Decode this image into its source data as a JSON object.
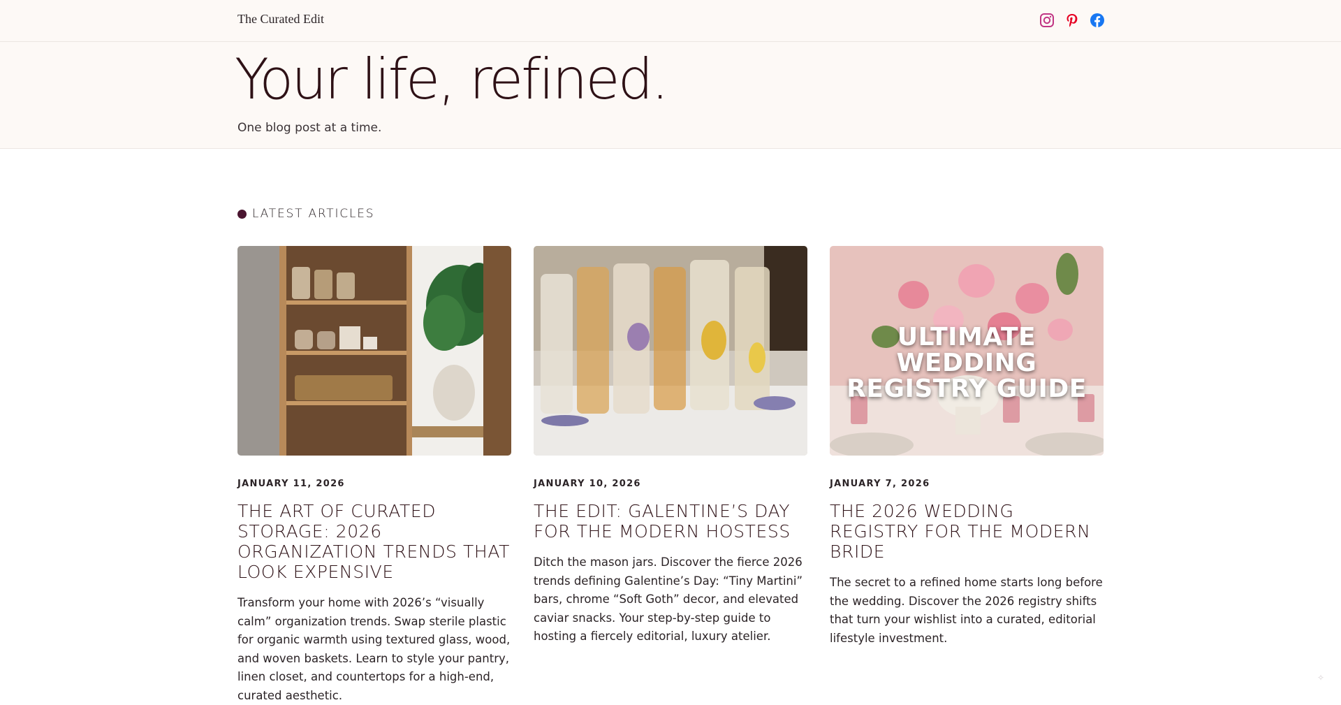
{
  "header": {
    "brand": "The Curated Edit",
    "social": [
      "instagram-icon",
      "pinterest-icon",
      "facebook-icon"
    ]
  },
  "hero": {
    "title": "Your life, refined.",
    "subtitle": "One blog post at a time."
  },
  "section": {
    "label": "LATEST ARTICLES"
  },
  "articles": [
    {
      "date": "JANUARY 11, 2026",
      "title": "THE ART OF CURATED STORAGE: 2026 ORGANIZATION TRENDS THAT LOOK EXPENSIVE",
      "excerpt": "Transform your home with 2026’s “visually calm” organization trends. Swap sterile plastic for organic warmth using textured glass, wood, and woven baskets. Learn to style your pantry, linen closet, and countertops for a high-end, curated aesthetic."
    },
    {
      "date": "JANUARY 10, 2026",
      "title": "THE EDIT: GALENTINE’S DAY FOR THE MODERN HOSTESS",
      "excerpt": "Ditch the mason jars. Discover the fierce 2026 trends defining Galentine’s Day: “Tiny Martini” bars, chrome “Soft Goth” decor, and elevated caviar snacks. Your step-by-step guide to hosting a fiercely editorial, luxury atelier."
    },
    {
      "date": "JANUARY 7, 2026",
      "title": "THE 2026 WEDDING REGISTRY FOR THE MODERN BRIDE",
      "excerpt": "The secret to a refined home starts long before the wedding. Discover the 2026 registry shifts that turn your wishlist into a curated, editorial lifestyle investment.",
      "image_overlay": "ULTIMATE WEDDING REGISTRY GUIDE"
    }
  ],
  "colors": {
    "brand_dark": "#2e1116",
    "accent_dot": "#4a1530",
    "header_bg": "#fdf9f6",
    "instagram": "#c13584",
    "pinterest": "#e60023",
    "facebook": "#1877f2"
  }
}
